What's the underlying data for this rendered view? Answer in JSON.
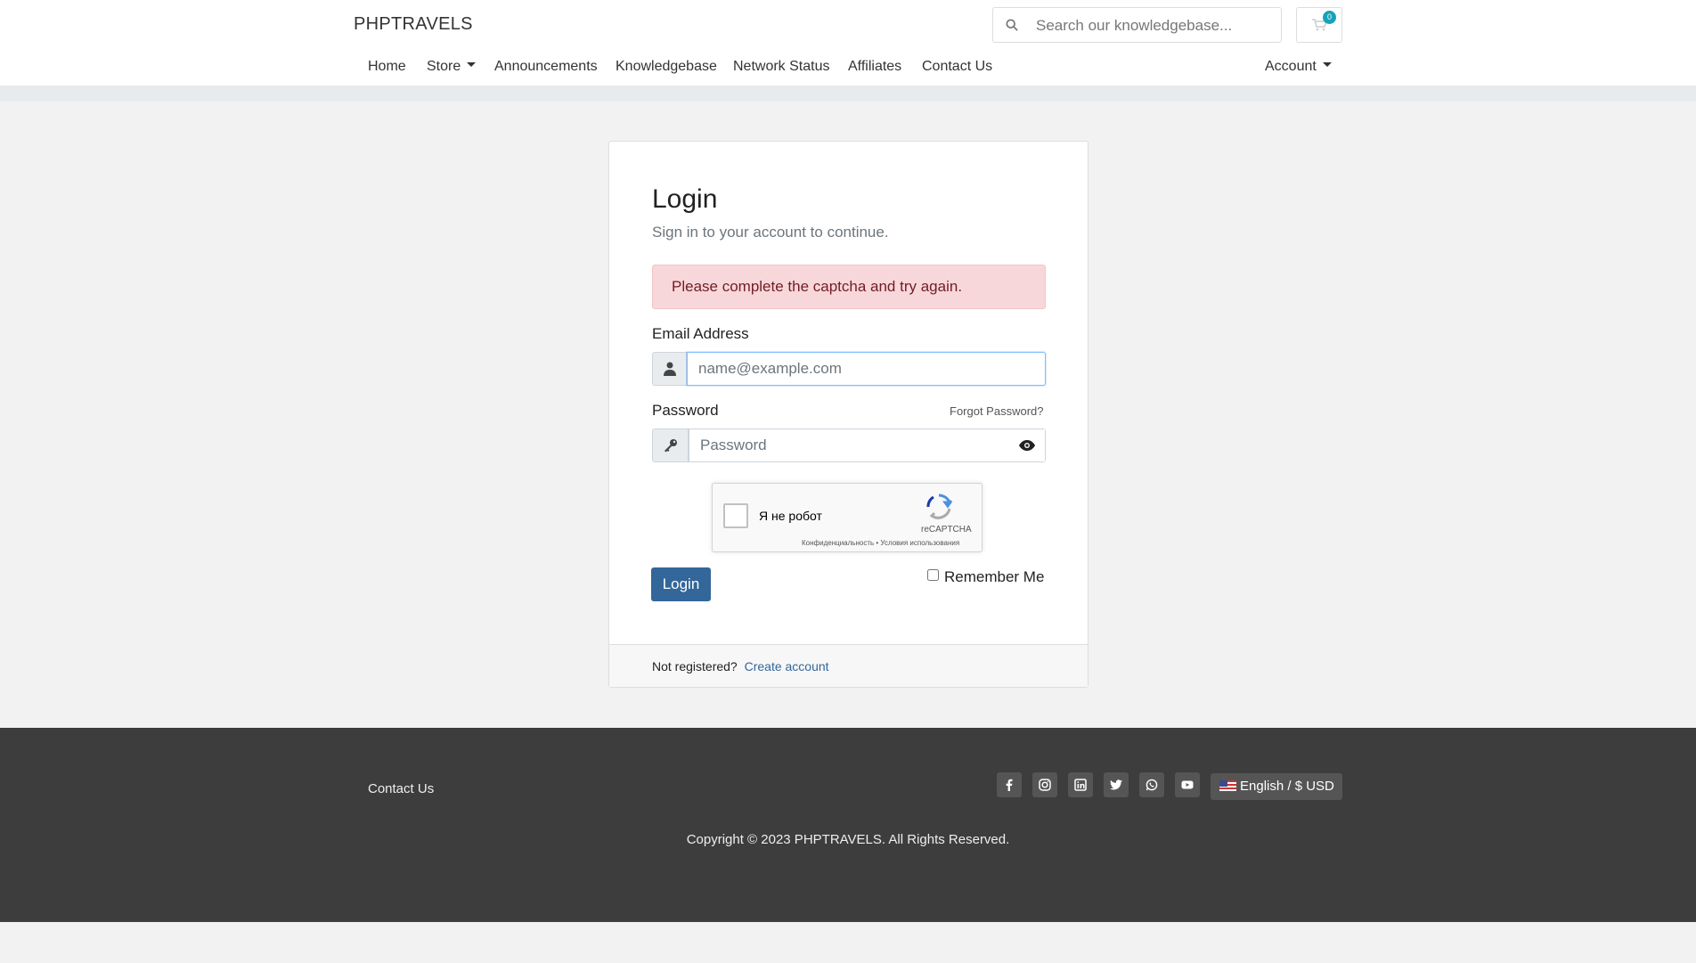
{
  "header": {
    "brand": "PHPTRAVELS",
    "search_placeholder": "Search our knowledgebase...",
    "cart_count": "0"
  },
  "nav": {
    "home": "Home",
    "store": "Store",
    "announcements": "Announcements",
    "knowledgebase": "Knowledgebase",
    "network_status": "Network Status",
    "affiliates": "Affiliates",
    "contact_us": "Contact Us",
    "account": "Account"
  },
  "login": {
    "title": "Login",
    "subtitle": "Sign in to your account to continue.",
    "alert": "Please complete the captcha and try again.",
    "email_label": "Email Address",
    "email_placeholder": "name@example.com",
    "password_label": "Password",
    "forgot": "Forgot Password?",
    "password_placeholder": "Password",
    "captcha_label": "Я не робот",
    "captcha_brand": "reCAPTCHA",
    "captcha_terms": "Конфиденциальность • Условия использования",
    "login_button": "Login",
    "remember_me": "Remember Me",
    "not_registered": "Not registered?",
    "create_account": "Create account"
  },
  "footer": {
    "contact_us": "Contact Us",
    "language": "English / $ USD",
    "copyright": "Copyright © 2023 PHPTRAVELS. All Rights Reserved.",
    "social_icons": [
      "facebook-icon",
      "instagram-icon",
      "linkedin-icon",
      "twitter-icon",
      "whatsapp-icon",
      "youtube-icon"
    ]
  },
  "colors": {
    "primary": "#336699",
    "alert_bg": "#f8d7da",
    "alert_text": "#721c24",
    "footer_bg": "#3d3d3d",
    "badge": "#17a2b8"
  }
}
